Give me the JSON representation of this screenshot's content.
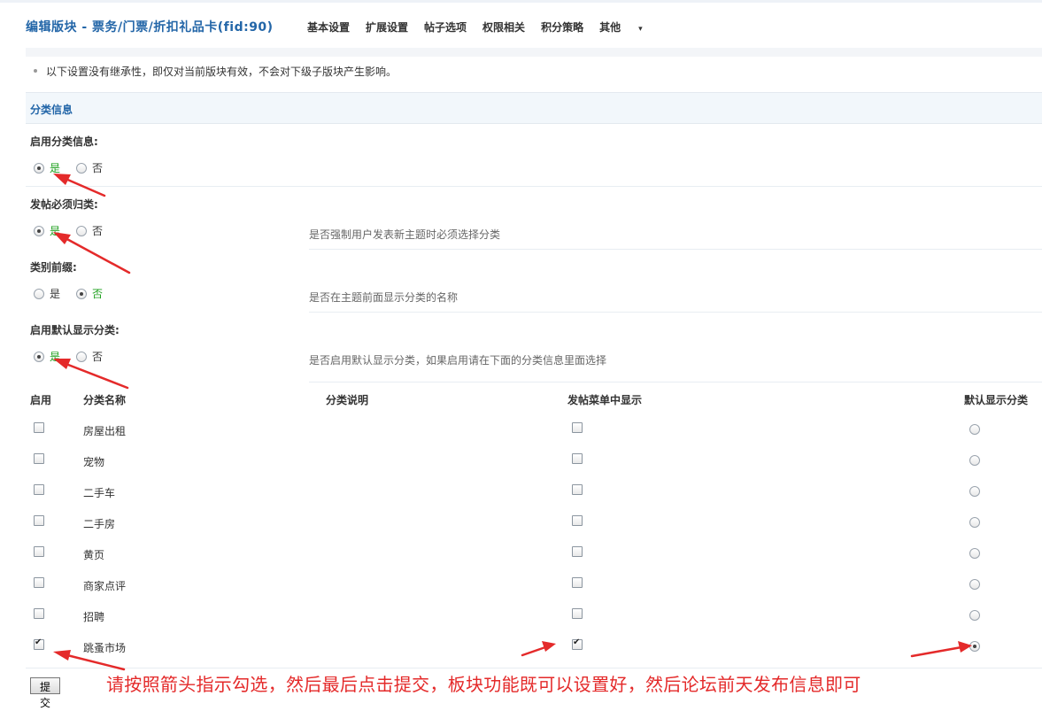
{
  "header": {
    "title": "编辑版块 - 票务/门票/折扣礼品卡(fid:90)",
    "nav": [
      "基本设置",
      "扩展设置",
      "帖子选项",
      "权限相关",
      "积分策略",
      "其他"
    ],
    "more_indicator": "▾"
  },
  "tip": "以下设置没有继承性，即仅对当前版块有效，不会对下级子版块产生影响。",
  "section": {
    "title": "分类信息"
  },
  "settings": [
    {
      "label": "启用分类信息:",
      "options": [
        "是",
        "否"
      ],
      "selected": "是",
      "desc": ""
    },
    {
      "label": "发帖必须归类:",
      "options": [
        "是",
        "否"
      ],
      "selected": "是",
      "desc": "是否强制用户发表新主题时必须选择分类"
    },
    {
      "label": "类别前缀:",
      "options": [
        "是",
        "否"
      ],
      "selected": "否",
      "desc": "是否在主题前面显示分类的名称"
    },
    {
      "label": "启用默认显示分类:",
      "options": [
        "是",
        "否"
      ],
      "selected": "是",
      "desc": "是否启用默认显示分类，如果启用请在下面的分类信息里面选择"
    }
  ],
  "table": {
    "headers": [
      "启用",
      "分类名称",
      "分类说明",
      "发帖菜单中显示",
      "默认显示分类"
    ],
    "rows": [
      {
        "enabled": false,
        "name": "房屋出租",
        "menu": false,
        "default": false
      },
      {
        "enabled": false,
        "name": "宠物",
        "menu": false,
        "default": false
      },
      {
        "enabled": false,
        "name": "二手车",
        "menu": false,
        "default": false
      },
      {
        "enabled": false,
        "name": "二手房",
        "menu": false,
        "default": false
      },
      {
        "enabled": false,
        "name": "黄页",
        "menu": false,
        "default": false
      },
      {
        "enabled": false,
        "name": "商家点评",
        "menu": false,
        "default": false
      },
      {
        "enabled": false,
        "name": "招聘",
        "menu": false,
        "default": false
      },
      {
        "enabled": true,
        "name": "跳蚤市场",
        "menu": true,
        "default": true
      }
    ]
  },
  "submit_label": "提交",
  "annotation": "请按照箭头指示勾选，然后最后点击提交，板块功能既可以设置好，然后论坛前天发布信息即可",
  "colors": {
    "accent": "#2366a8",
    "selected_option": "#1c9f1c",
    "annotation": "#e42a2a"
  }
}
